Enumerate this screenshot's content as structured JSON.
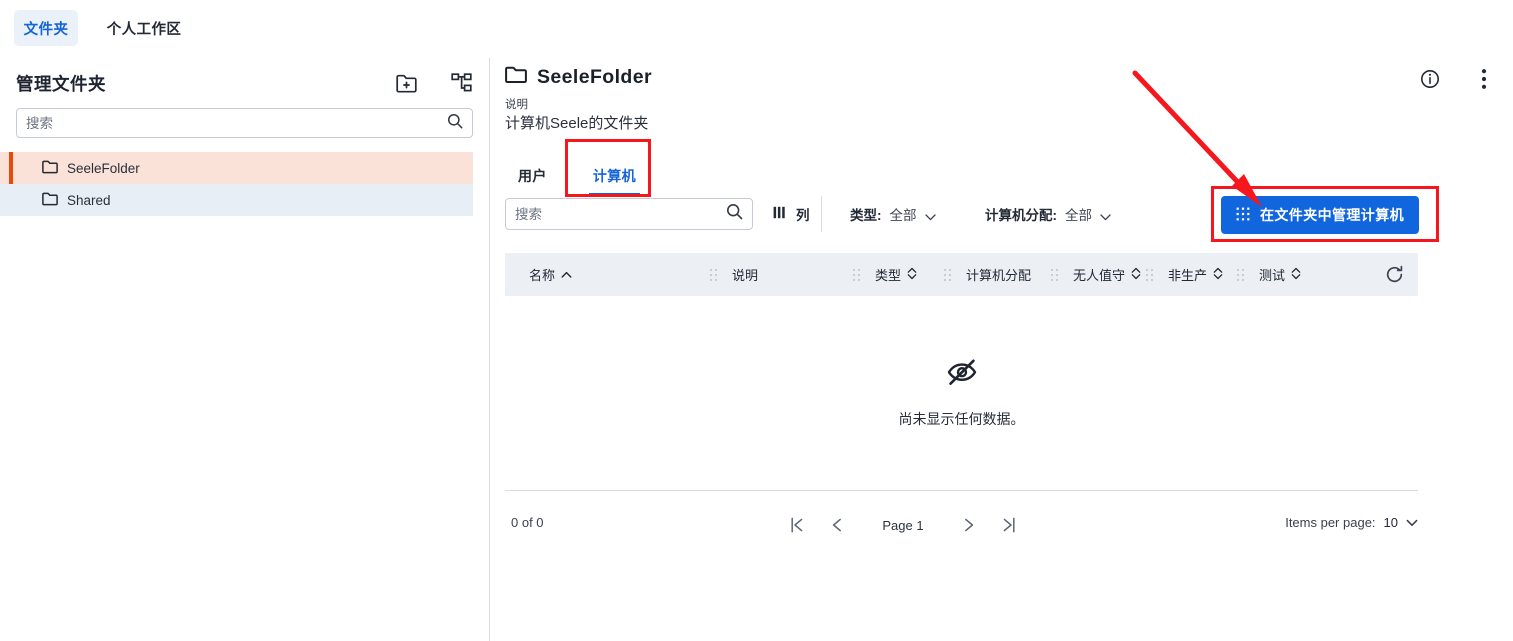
{
  "topnav": {
    "tabs": [
      {
        "label": "文件夹",
        "active": true
      },
      {
        "label": "个人工作区",
        "active": false
      }
    ]
  },
  "sidebar": {
    "title": "管理文件夹",
    "new_folder_icon": "new-folder-icon",
    "hierarchy_icon": "hierarchy-icon",
    "search": {
      "placeholder": "搜索",
      "value": ""
    },
    "items": [
      {
        "label": "SeeleFolder",
        "selected": true
      },
      {
        "label": "Shared",
        "selected": false
      }
    ]
  },
  "main": {
    "page_title": "SeeleFolder",
    "folder_icon": "folder-icon",
    "description_label": "说明",
    "description_value": "计算机Seele的文件夹",
    "header_icons": [
      {
        "name": "info-icon"
      },
      {
        "name": "more-vertical-icon"
      }
    ],
    "tabs": [
      {
        "label": "用户",
        "active": false
      },
      {
        "label": "计算机",
        "active": true
      }
    ],
    "toolbar": {
      "search": {
        "placeholder": "搜索",
        "value": ""
      },
      "columns_label": "列",
      "columns_icon": "columns-icon",
      "type_filter_label": "类型:",
      "type_filter_value": "全部",
      "assign_filter_label": "计算机分配:",
      "assign_filter_value": "全部",
      "primary_button_label": "在文件夹中管理计算机",
      "primary_button_icon": "grid-apps-icon"
    },
    "table": {
      "columns": [
        {
          "label": "名称",
          "sort": "asc"
        },
        {
          "label": "说明",
          "sort": "none"
        },
        {
          "label": "类型",
          "sort": "both"
        },
        {
          "label": "计算机分配",
          "sort": "none"
        },
        {
          "label": "无人值守",
          "sort": "both"
        },
        {
          "label": "非生产",
          "sort": "both"
        },
        {
          "label": "测试",
          "sort": "both"
        }
      ],
      "refresh_icon": "refresh-icon",
      "empty_icon": "eye-off-icon",
      "empty_text": "尚未显示任何数据。",
      "rows": []
    },
    "paginator": {
      "count_text": "0 of 0",
      "first_label": "|⟨",
      "prev_label": "⟨",
      "page_label": "Page 1",
      "next_label": "⟩",
      "last_label": "⟩|",
      "items_per_page_label": "Items per page:",
      "items_per_page_value": "10"
    }
  },
  "annotations": {
    "highlight_tab": "计算机",
    "highlight_button": "在文件夹中管理计算机",
    "arrow_color": "#f5171d",
    "box_color": "#f5171d"
  },
  "colors": {
    "accent_blue": "#1266dd",
    "tab_active_blue": "#1565d8",
    "selected_folder_bg": "#fbe2d8",
    "selected_folder_bar": "#e8490f",
    "alt_folder_bg": "#e8eef6",
    "table_head_bg": "#eceff4",
    "annotation_red": "#f5171d"
  }
}
